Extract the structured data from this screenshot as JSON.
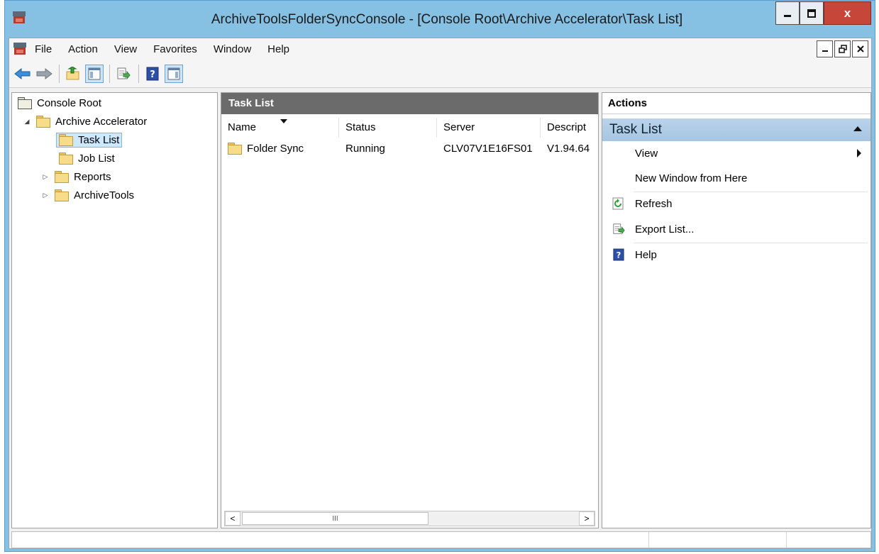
{
  "window": {
    "title": "ArchiveToolsFolderSyncConsole - [Console Root\\Archive Accelerator\\Task List]",
    "close_glyph": "x"
  },
  "menubar": {
    "items": [
      "File",
      "Action",
      "View",
      "Favorites",
      "Window",
      "Help"
    ]
  },
  "toolbar": {
    "buttons": [
      "back-arrow-icon",
      "forward-arrow-icon",
      "up-folder-icon",
      "show-hide-tree-icon",
      "export-list-icon",
      "help-icon",
      "show-hide-action-pane-icon"
    ]
  },
  "tree": {
    "root": "Console Root",
    "archive_accelerator": "Archive Accelerator",
    "task_list": "Task List",
    "job_list": "Job List",
    "reports": "Reports",
    "archive_tools": "ArchiveTools"
  },
  "center": {
    "header": "Task List",
    "columns": [
      "Name",
      "Status",
      "Server",
      "Descript"
    ],
    "rows": [
      {
        "name": "Folder Sync",
        "status": "Running",
        "server": "CLV07V1E16FS01",
        "description": "V1.94.64"
      }
    ],
    "scroll_left": "<",
    "scroll_right": ">",
    "scroll_thumb": "III"
  },
  "actions": {
    "header": "Actions",
    "section": "Task List",
    "items": {
      "view": "View",
      "new_window": "New Window from Here",
      "refresh": "Refresh",
      "export_list": "Export List...",
      "help": "Help"
    }
  },
  "colors": {
    "frame": "#86c0e3",
    "close_button": "#c7463a",
    "pane_header": "#6b6b6b",
    "action_section": "#b9d3ea"
  }
}
